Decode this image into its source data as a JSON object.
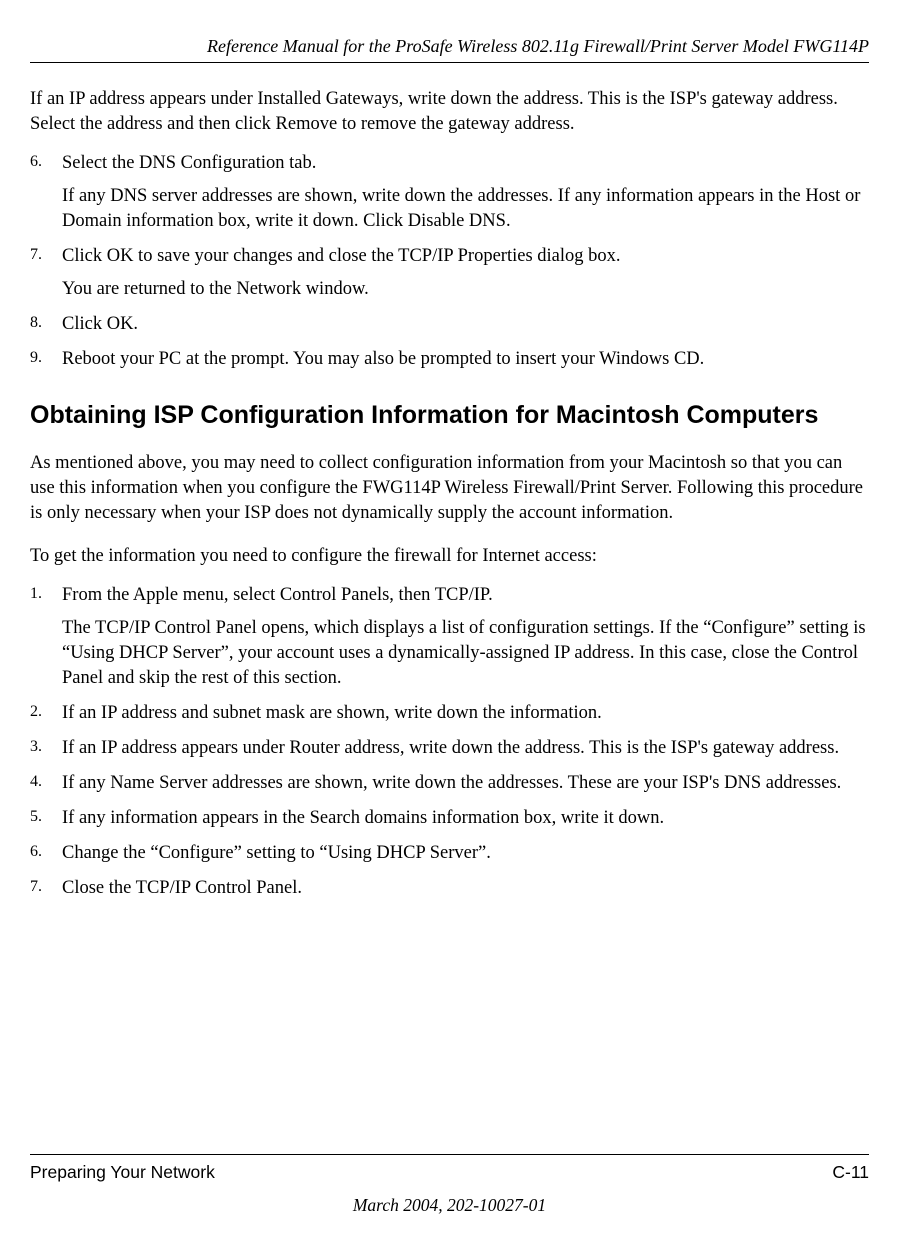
{
  "header": "Reference Manual for the ProSafe Wireless 802.11g  Firewall/Print Server Model FWG114P",
  "top": {
    "continued": "If an IP address appears under Installed Gateways, write down the address. This is the ISP's gateway address. Select the address and then click Remove to remove the gateway address.",
    "items": [
      {
        "n": "6.",
        "text": "Select the DNS Configuration tab.",
        "sub": "If any DNS server addresses are shown, write down the addresses. If any information appears in the Host or Domain information box, write it down. Click Disable DNS."
      },
      {
        "n": "7.",
        "text": "Click OK to save your changes and close the TCP/IP Properties dialog box.",
        "sub": "You are returned to the Network window."
      },
      {
        "n": "8.",
        "text": "Click OK."
      },
      {
        "n": "9.",
        "text": "Reboot your PC at the prompt. You may also be prompted to insert your Windows CD."
      }
    ]
  },
  "section_heading": "Obtaining ISP Configuration Information for Macintosh Computers",
  "intro1": "As mentioned above, you may need to collect configuration information from your Macintosh so that you can use this information when you configure the FWG114P Wireless Firewall/Print Server. Following this procedure is only necessary when your ISP does not dynamically supply the account information.",
  "intro2": "To get the information you need to configure the firewall for Internet access:",
  "list2": [
    {
      "n": "1.",
      "text": "From the Apple menu, select Control Panels, then TCP/IP.",
      "sub": "The TCP/IP Control Panel opens, which displays a list of configuration settings. If the “Configure” setting is “Using DHCP Server”, your account uses a dynamically-assigned IP address. In this case, close the Control Panel and skip the rest of this section."
    },
    {
      "n": "2.",
      "text": "If an IP address and subnet mask are shown, write down the information."
    },
    {
      "n": "3.",
      "text": "If an IP address appears under Router address, write down the address. This is the ISP's gateway address."
    },
    {
      "n": "4.",
      "text": "If any Name Server addresses are shown, write down the addresses. These are your ISP's DNS addresses."
    },
    {
      "n": "5.",
      "text": "If any information appears in the Search domains information box, write it down."
    },
    {
      "n": "6.",
      "text": "Change the “Configure” setting to “Using DHCP Server”."
    },
    {
      "n": "7.",
      "text": "Close the TCP/IP Control Panel."
    }
  ],
  "footer": {
    "left": "Preparing Your Network",
    "right": "C-11",
    "center": "March 2004, 202-10027-01"
  }
}
